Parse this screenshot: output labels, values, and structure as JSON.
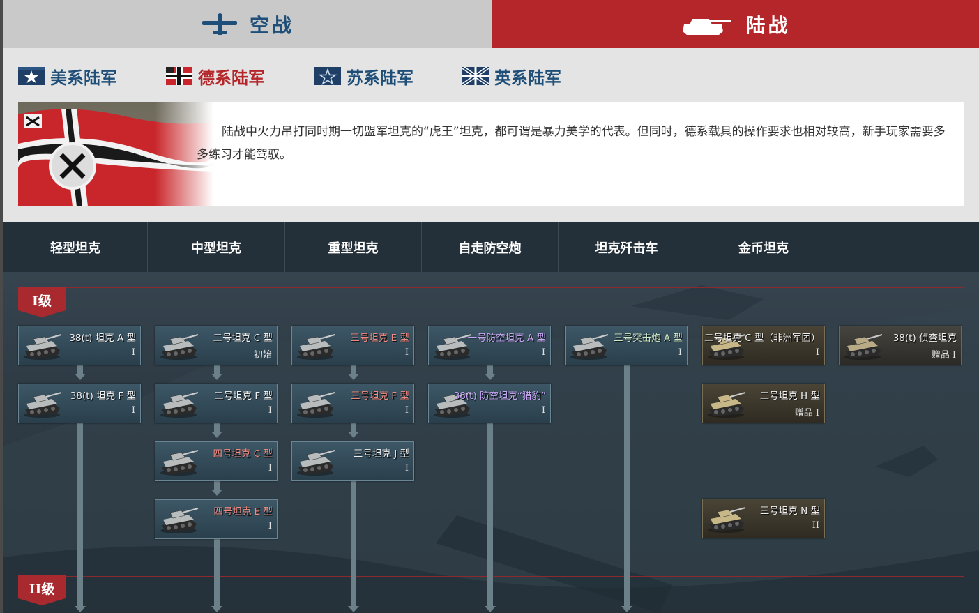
{
  "tabs": {
    "air": {
      "label": "空战",
      "icon": "plane-icon"
    },
    "ground": {
      "label": "陆战",
      "icon": "tank-icon",
      "active": true
    }
  },
  "nations": [
    {
      "label": "美系陆军",
      "icon": "usa-flag-icon"
    },
    {
      "label": "德系陆军",
      "icon": "germany-flag-icon",
      "active": true
    },
    {
      "label": "苏系陆军",
      "icon": "ussr-flag-icon"
    },
    {
      "label": "英系陆军",
      "icon": "uk-flag-icon"
    }
  ],
  "description": "陆战中火力吊打同时期一切盟军坦克的“虎王”坦克，都可谓是暴力美学的代表。但同时，德系载具的操作要求也相对较高，新手玩家需要多多练习才能驾驭。",
  "categories": [
    "轻型坦克",
    "中型坦克",
    "重型坦克",
    "自走防空炮",
    "坦克歼击车",
    "金币坦克"
  ],
  "ranks": [
    "I级",
    "II级"
  ],
  "vehicles": [
    {
      "name": "38(t) 坦克 A 型",
      "tier": "I",
      "style": "normal",
      "color": "white"
    },
    {
      "name": "38(t) 坦克 F 型",
      "tier": "I",
      "style": "normal",
      "color": "white"
    },
    {
      "name": "二号坦克 C 型",
      "tier": "初始",
      "style": "normal",
      "color": "white"
    },
    {
      "name": "二号坦克 F 型",
      "tier": "I",
      "style": "normal",
      "color": "white"
    },
    {
      "name": "四号坦克 C 型",
      "tier": "I",
      "style": "normal",
      "color": "red"
    },
    {
      "name": "四号坦克 E 型",
      "tier": "I",
      "style": "normal",
      "color": "red"
    },
    {
      "name": "三号坦克 E 型",
      "tier": "I",
      "style": "normal",
      "color": "red"
    },
    {
      "name": "三号坦克 F 型",
      "tier": "I",
      "style": "normal",
      "color": "red"
    },
    {
      "name": "三号坦克 J 型",
      "tier": "I",
      "style": "normal",
      "color": "white"
    },
    {
      "name": "一号防空坦克 A 型",
      "tier": "I",
      "style": "normal",
      "color": "purple"
    },
    {
      "name": "38(t) 防空坦克“猎豹”",
      "tier": "I",
      "style": "normal",
      "color": "purple"
    },
    {
      "name": "三号突击炮 A 型",
      "tier": "I",
      "style": "normal",
      "color": "green"
    },
    {
      "name": "二号坦克 C 型（非洲军团）",
      "tier": "I",
      "style": "prem",
      "color": "white"
    },
    {
      "name": "二号坦克 H 型",
      "tier": "赠品 I",
      "style": "prem",
      "color": "white"
    },
    {
      "name": "三号坦克 N 型",
      "tier": "II",
      "style": "prem",
      "color": "white"
    },
    {
      "name": "38(t) 侦查坦克",
      "tier": "赠品 I",
      "style": "gift",
      "color": "white"
    }
  ],
  "colors": {
    "accent_red": "#b4262a",
    "nation_blue": "#1f4f78",
    "tree_bg": "#2f3c46"
  }
}
